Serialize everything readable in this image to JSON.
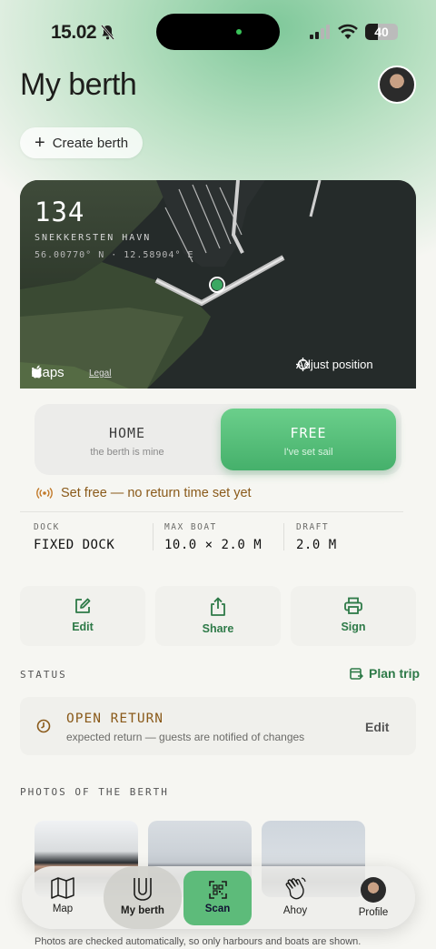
{
  "status_bar": {
    "time": "15.02",
    "battery": "40",
    "battery_level": 0.4
  },
  "header": {
    "title": "My berth",
    "create_label": "Create berth"
  },
  "map": {
    "berth_number": "134",
    "harbour": "SNEKKERSTEN HAVN",
    "coordinates": "56.00770° N · 12.58904° E",
    "maps_label": "Maps",
    "legal_label": "Legal",
    "adjust_label": "Adjust position"
  },
  "toggle": {
    "home": {
      "title": "HOME",
      "subtitle": "the berth is mine"
    },
    "free": {
      "title": "FREE",
      "subtitle": "I've set sail"
    },
    "selected": "free"
  },
  "alert": "Set free — no return time set yet",
  "specs": [
    {
      "label": "DOCK",
      "value": "FIXED DOCK"
    },
    {
      "label": "MAX BOAT",
      "value": "10.0 × 2.0 M"
    },
    {
      "label": "DRAFT",
      "value": "2.0 M"
    }
  ],
  "actions": [
    {
      "label": "Edit",
      "icon": "edit-icon"
    },
    {
      "label": "Share",
      "icon": "share-icon"
    },
    {
      "label": "Sign",
      "icon": "printer-icon"
    }
  ],
  "status_section": {
    "label": "STATUS",
    "plan_trip": "Plan trip",
    "title": "OPEN RETURN",
    "description": "expected return — guests are notified of changes",
    "edit_label": "Edit"
  },
  "photos_section": {
    "label": "PHOTOS OF THE BERTH",
    "footnote": "Photos are checked automatically, so only harbours and boats are shown."
  },
  "tabbar": [
    {
      "label": "Map",
      "icon": "map-icon"
    },
    {
      "label": "My berth",
      "icon": "berth-icon",
      "active": true
    },
    {
      "label": "Scan",
      "icon": "qr-scan-icon"
    },
    {
      "label": "Ahoy",
      "icon": "wave-hand-icon"
    },
    {
      "label": "Profile",
      "icon": "profile-avatar"
    }
  ],
  "colors": {
    "accent": "#2e7a48",
    "free_green": "#5dbb7a",
    "warning": "#8a5a1a"
  }
}
